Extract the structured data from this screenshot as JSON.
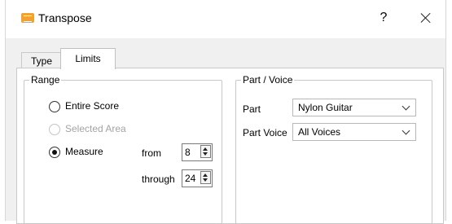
{
  "window": {
    "title": "Transpose",
    "help_label": "?",
    "app_icon": "app-icon",
    "close_icon": "close-icon"
  },
  "tabs": [
    {
      "label": "Type",
      "selected": false
    },
    {
      "label": "Limits",
      "selected": true
    }
  ],
  "range": {
    "group_title": "Range",
    "options": [
      {
        "label": "Entire Score",
        "checked": false,
        "enabled": true
      },
      {
        "label": "Selected Area",
        "checked": false,
        "enabled": false
      },
      {
        "label": "Measure",
        "checked": true,
        "enabled": true
      }
    ],
    "from_label": "from",
    "from_value": "8",
    "through_label": "through",
    "through_value": "24"
  },
  "part_voice": {
    "group_title": "Part / Voice",
    "part_label": "Part",
    "part_value": "Nylon Guitar",
    "voice_label": "Part Voice",
    "voice_value": "All Voices"
  }
}
